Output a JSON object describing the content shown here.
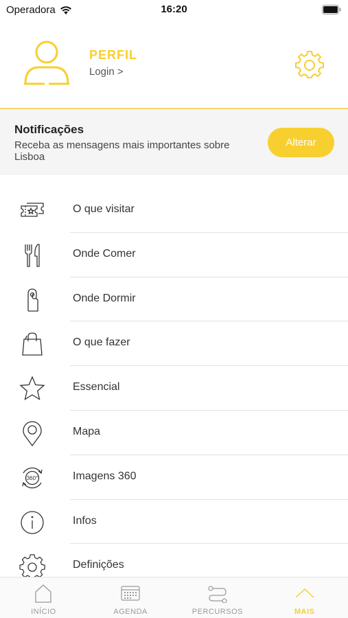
{
  "status_bar": {
    "carrier": "Operadora",
    "time": "16:20"
  },
  "profile": {
    "title": "PERFIL",
    "login": "Login >"
  },
  "notifications": {
    "title": "Notificações",
    "text": "Receba as mensagens mais importantes sobre Lisboa",
    "button": "Alterar"
  },
  "menu": [
    {
      "label": "O que visitar",
      "icon": "tickets-icon"
    },
    {
      "label": "Onde Comer",
      "icon": "cutlery-icon"
    },
    {
      "label": "Onde Dormir",
      "icon": "door-hanger-icon"
    },
    {
      "label": "O que fazer",
      "icon": "shopping-bag-icon"
    },
    {
      "label": "Essencial",
      "icon": "star-icon"
    },
    {
      "label": "Mapa",
      "icon": "map-pin-icon"
    },
    {
      "label": "Imagens 360",
      "icon": "360-icon"
    },
    {
      "label": "Infos",
      "icon": "info-icon"
    },
    {
      "label": "Definições",
      "icon": "gear-icon"
    }
  ],
  "tabbar": [
    {
      "label": "INÍCIO",
      "icon": "home-icon",
      "active": false
    },
    {
      "label": "AGENDA",
      "icon": "calendar-icon",
      "active": false
    },
    {
      "label": "PERCURSOS",
      "icon": "route-icon",
      "active": false
    },
    {
      "label": "MAIS",
      "icon": "chevron-up-icon",
      "active": true
    }
  ],
  "colors": {
    "accent": "#f7cf2f",
    "text": "#333333",
    "separator": "#e2e2e2",
    "panel": "#f5f5f5"
  }
}
